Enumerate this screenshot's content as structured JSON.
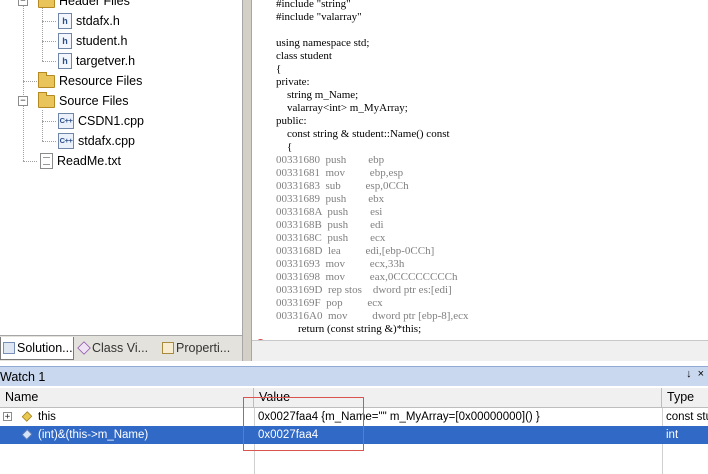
{
  "solution_explorer": {
    "items": [
      {
        "label": "Header Files",
        "icon": "folder-icon"
      },
      {
        "label": "stdafx.h",
        "icon": "header-file-icon"
      },
      {
        "label": "student.h",
        "icon": "header-file-icon"
      },
      {
        "label": "targetver.h",
        "icon": "header-file-icon"
      },
      {
        "label": "Resource Files",
        "icon": "folder-icon"
      },
      {
        "label": "Source Files",
        "icon": "folder-open-icon"
      },
      {
        "label": "CSDN1.cpp",
        "icon": "cpp-file-icon"
      },
      {
        "label": "stdafx.cpp",
        "icon": "cpp-file-icon"
      },
      {
        "label": "ReadMe.txt",
        "icon": "text-file-icon"
      }
    ],
    "tabs": [
      {
        "label": "Solution...",
        "icon": "solution-icon"
      },
      {
        "label": "Class Vi...",
        "icon": "class-view-icon"
      },
      {
        "label": "Properti...",
        "icon": "properties-icon"
      }
    ]
  },
  "code_editor": {
    "lines": [
      {
        "text": "#include \"string\"",
        "kind": "source"
      },
      {
        "text": "#include \"valarray\"",
        "kind": "source"
      },
      {
        "text": "",
        "kind": "source"
      },
      {
        "text": "using namespace std;",
        "kind": "source"
      },
      {
        "text": "class student",
        "kind": "source"
      },
      {
        "text": "{",
        "kind": "source"
      },
      {
        "text": "private:",
        "kind": "source"
      },
      {
        "text": "    string m_Name;",
        "kind": "source"
      },
      {
        "text": "    valarray<int> m_MyArray;",
        "kind": "source"
      },
      {
        "text": "public:",
        "kind": "source"
      },
      {
        "text": "    const string & student::Name() const",
        "kind": "source"
      },
      {
        "text": "    {",
        "kind": "source"
      },
      {
        "text": "00331680  push        ebp",
        "kind": "disasm"
      },
      {
        "text": "00331681  mov         ebp,esp",
        "kind": "disasm"
      },
      {
        "text": "00331683  sub         esp,0CCh",
        "kind": "disasm"
      },
      {
        "text": "00331689  push        ebx",
        "kind": "disasm"
      },
      {
        "text": "0033168A  push        esi",
        "kind": "disasm"
      },
      {
        "text": "0033168B  push        edi",
        "kind": "disasm"
      },
      {
        "text": "0033168C  push        ecx",
        "kind": "disasm"
      },
      {
        "text": "0033168D  lea         edi,[ebp-0CCh]",
        "kind": "disasm"
      },
      {
        "text": "00331693  mov         ecx,33h",
        "kind": "disasm"
      },
      {
        "text": "00331698  mov         eax,0CCCCCCCCh",
        "kind": "disasm"
      },
      {
        "text": "0033169D  rep stos    dword ptr es:[edi]",
        "kind": "disasm"
      },
      {
        "text": "0033169F  pop         ecx",
        "kind": "disasm"
      },
      {
        "text": "003316A0  mov         dword ptr [ebp-8],ecx",
        "kind": "disasm"
      },
      {
        "text": "        return (const string &)*this;",
        "kind": "source"
      }
    ]
  },
  "watch": {
    "title": "Watch 1",
    "pin_button": "↓",
    "close_button": "×",
    "columns": [
      "Name",
      "Value",
      "Type"
    ],
    "rows": [
      {
        "name": "this",
        "value": "0x0027faa4 {m_Name=\"\" m_MyArray=[0x00000000]() }",
        "type": "const stu",
        "expander": "+",
        "icon": "variable-icon",
        "selected": false
      },
      {
        "name": "(int)&(this->m_Name)",
        "value": "0x0027faa4",
        "type": "int",
        "expander": "",
        "icon": "expression-icon",
        "selected": true
      }
    ]
  },
  "colors": {
    "selection": "#3169c6",
    "highlight_box": "#d9534f",
    "watch_titlebar": "#c9d8ee",
    "disassembly_text": "#808080"
  }
}
